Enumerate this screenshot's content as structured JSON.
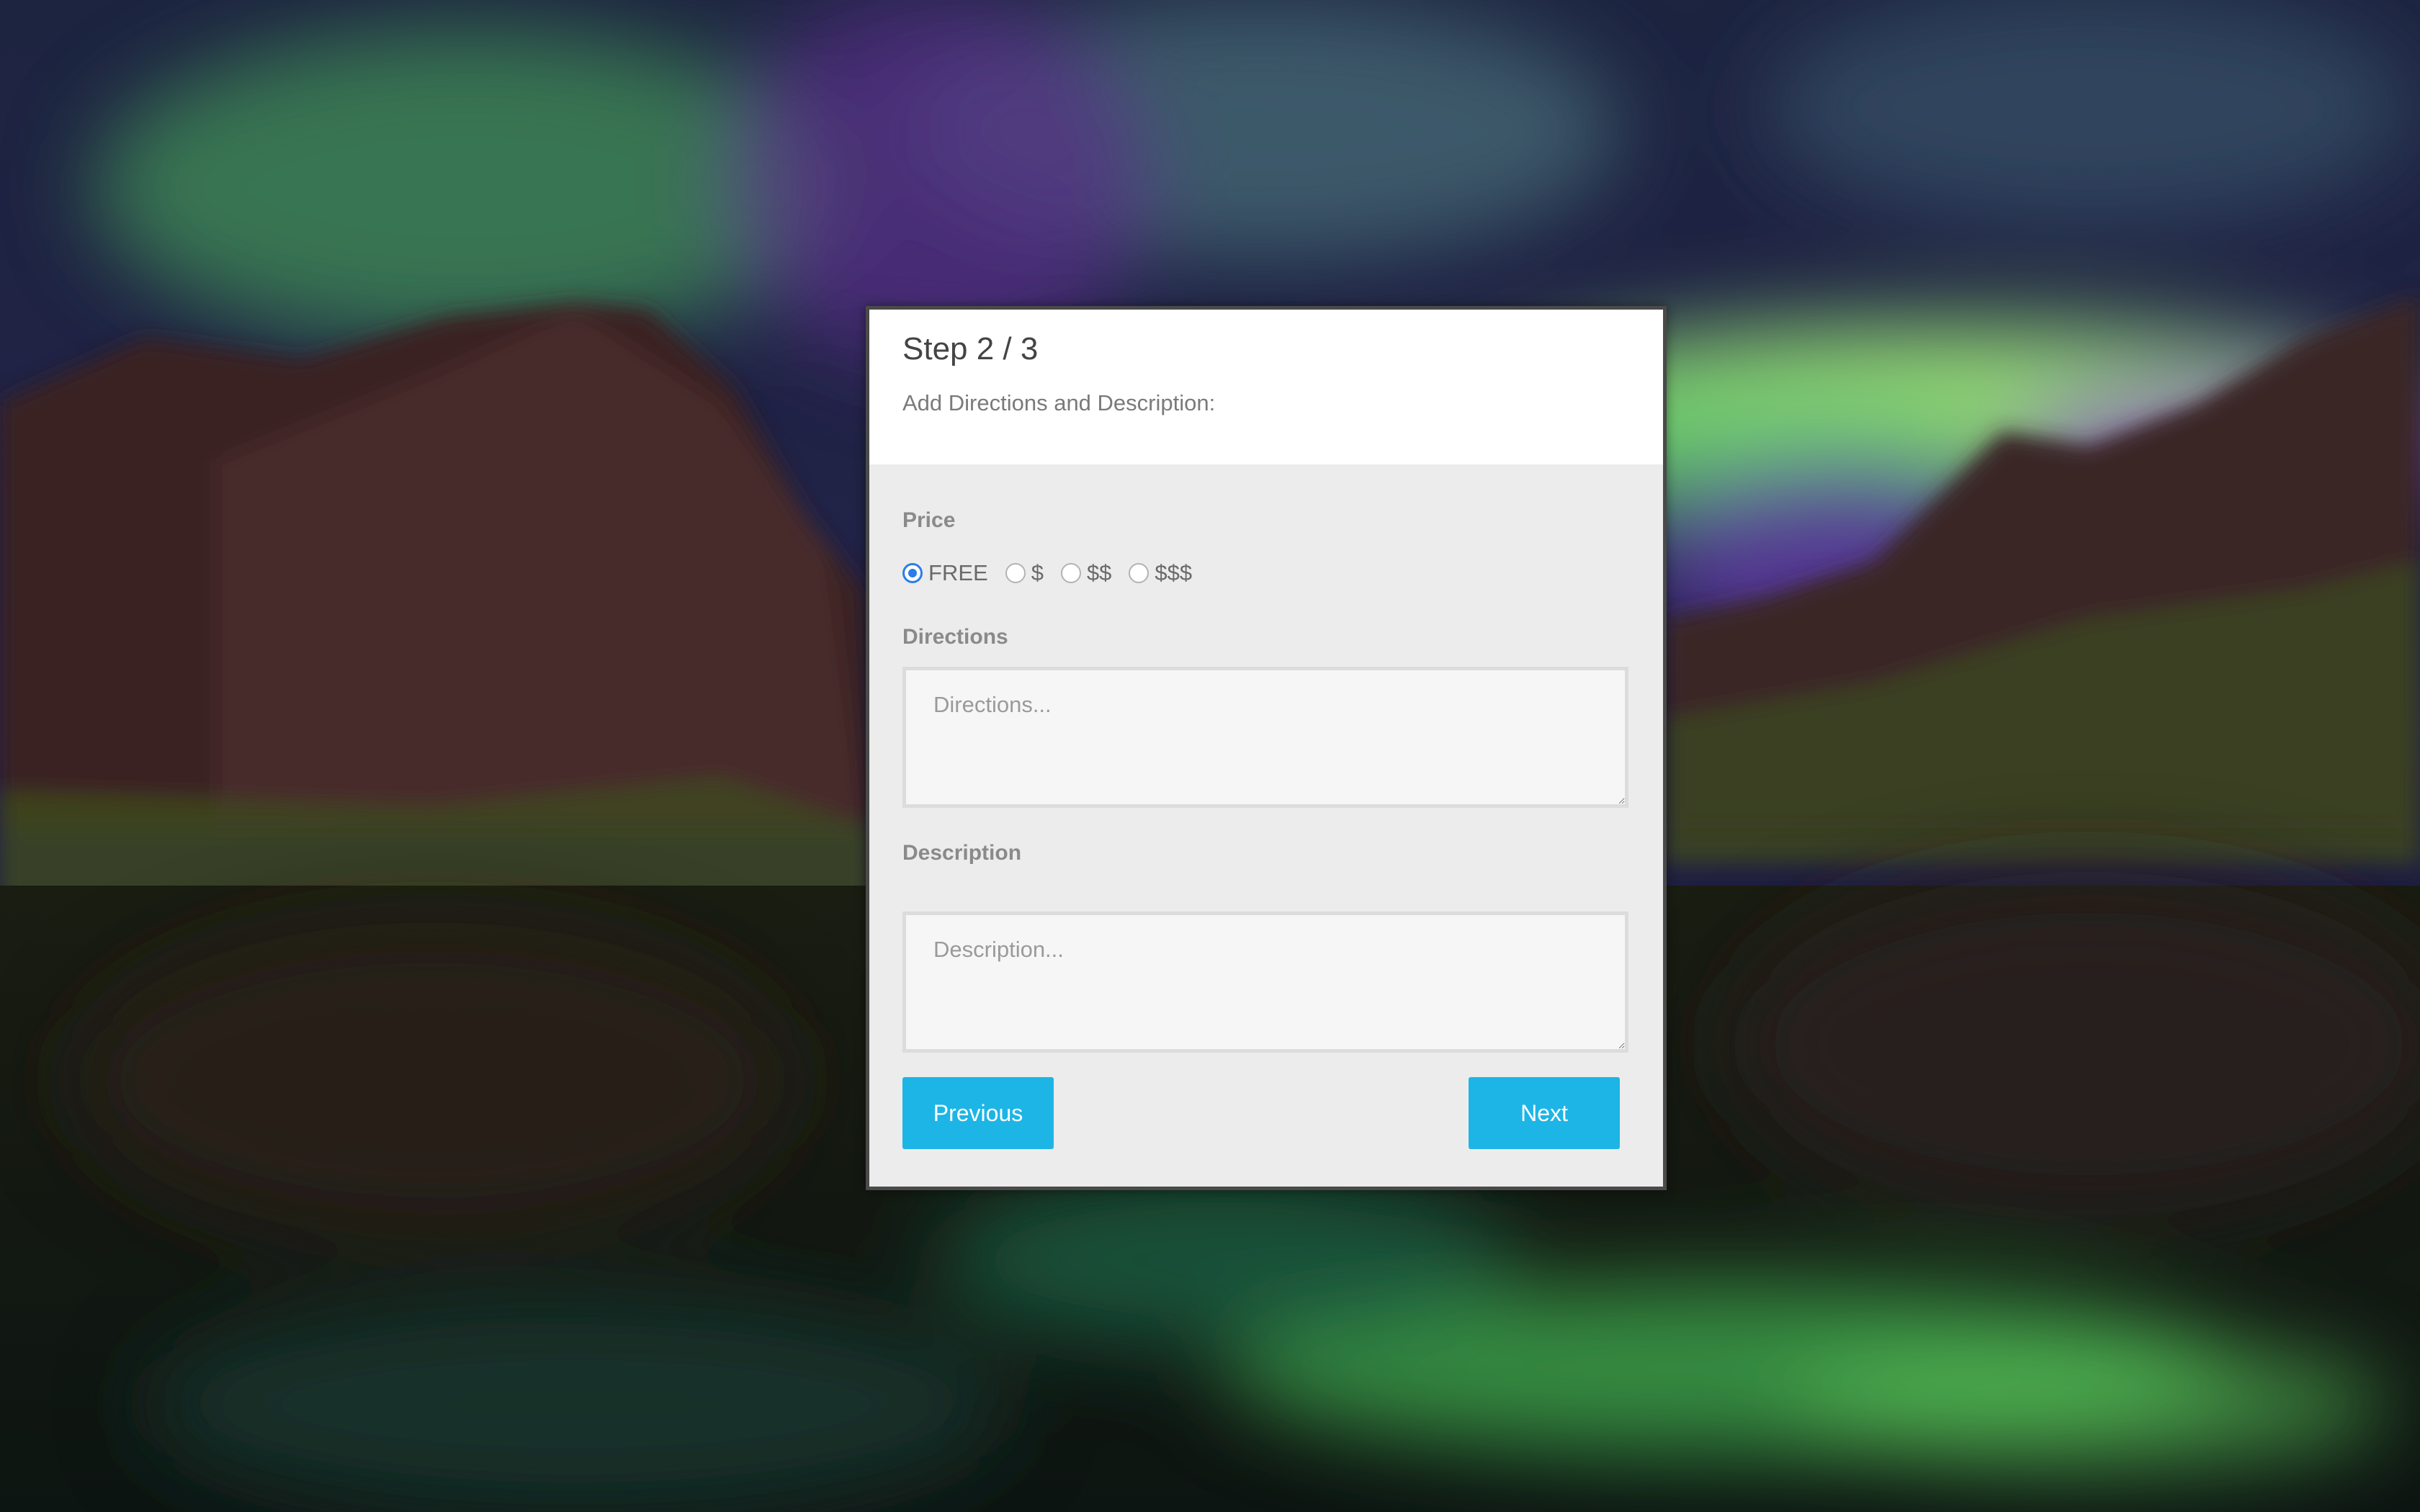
{
  "background": {
    "description": "blurred photo of aurora borealis over mountains reflected in a lake",
    "colors": {
      "sky_dark": "#1a1f3a",
      "aurora_green": "#6fd36a",
      "aurora_purple": "#5b2f8a",
      "mountain": "#3a2626",
      "valley_green": "#3e4a1e",
      "water": "#0f2420"
    }
  },
  "form": {
    "step": "Step 2 / 3",
    "subtitle": "Add Directions and Description:",
    "price": {
      "label": "Price",
      "options": [
        {
          "label": "FREE",
          "checked": true
        },
        {
          "label": "$",
          "checked": false
        },
        {
          "label": "$$",
          "checked": false
        },
        {
          "label": "$$$",
          "checked": false
        }
      ]
    },
    "directions": {
      "label": "Directions",
      "placeholder": "Directions...",
      "value": ""
    },
    "description": {
      "label": "Description",
      "placeholder": "Description...",
      "value": ""
    },
    "buttons": {
      "previous": "Previous",
      "next": "Next",
      "color": "#1db5e6"
    }
  }
}
